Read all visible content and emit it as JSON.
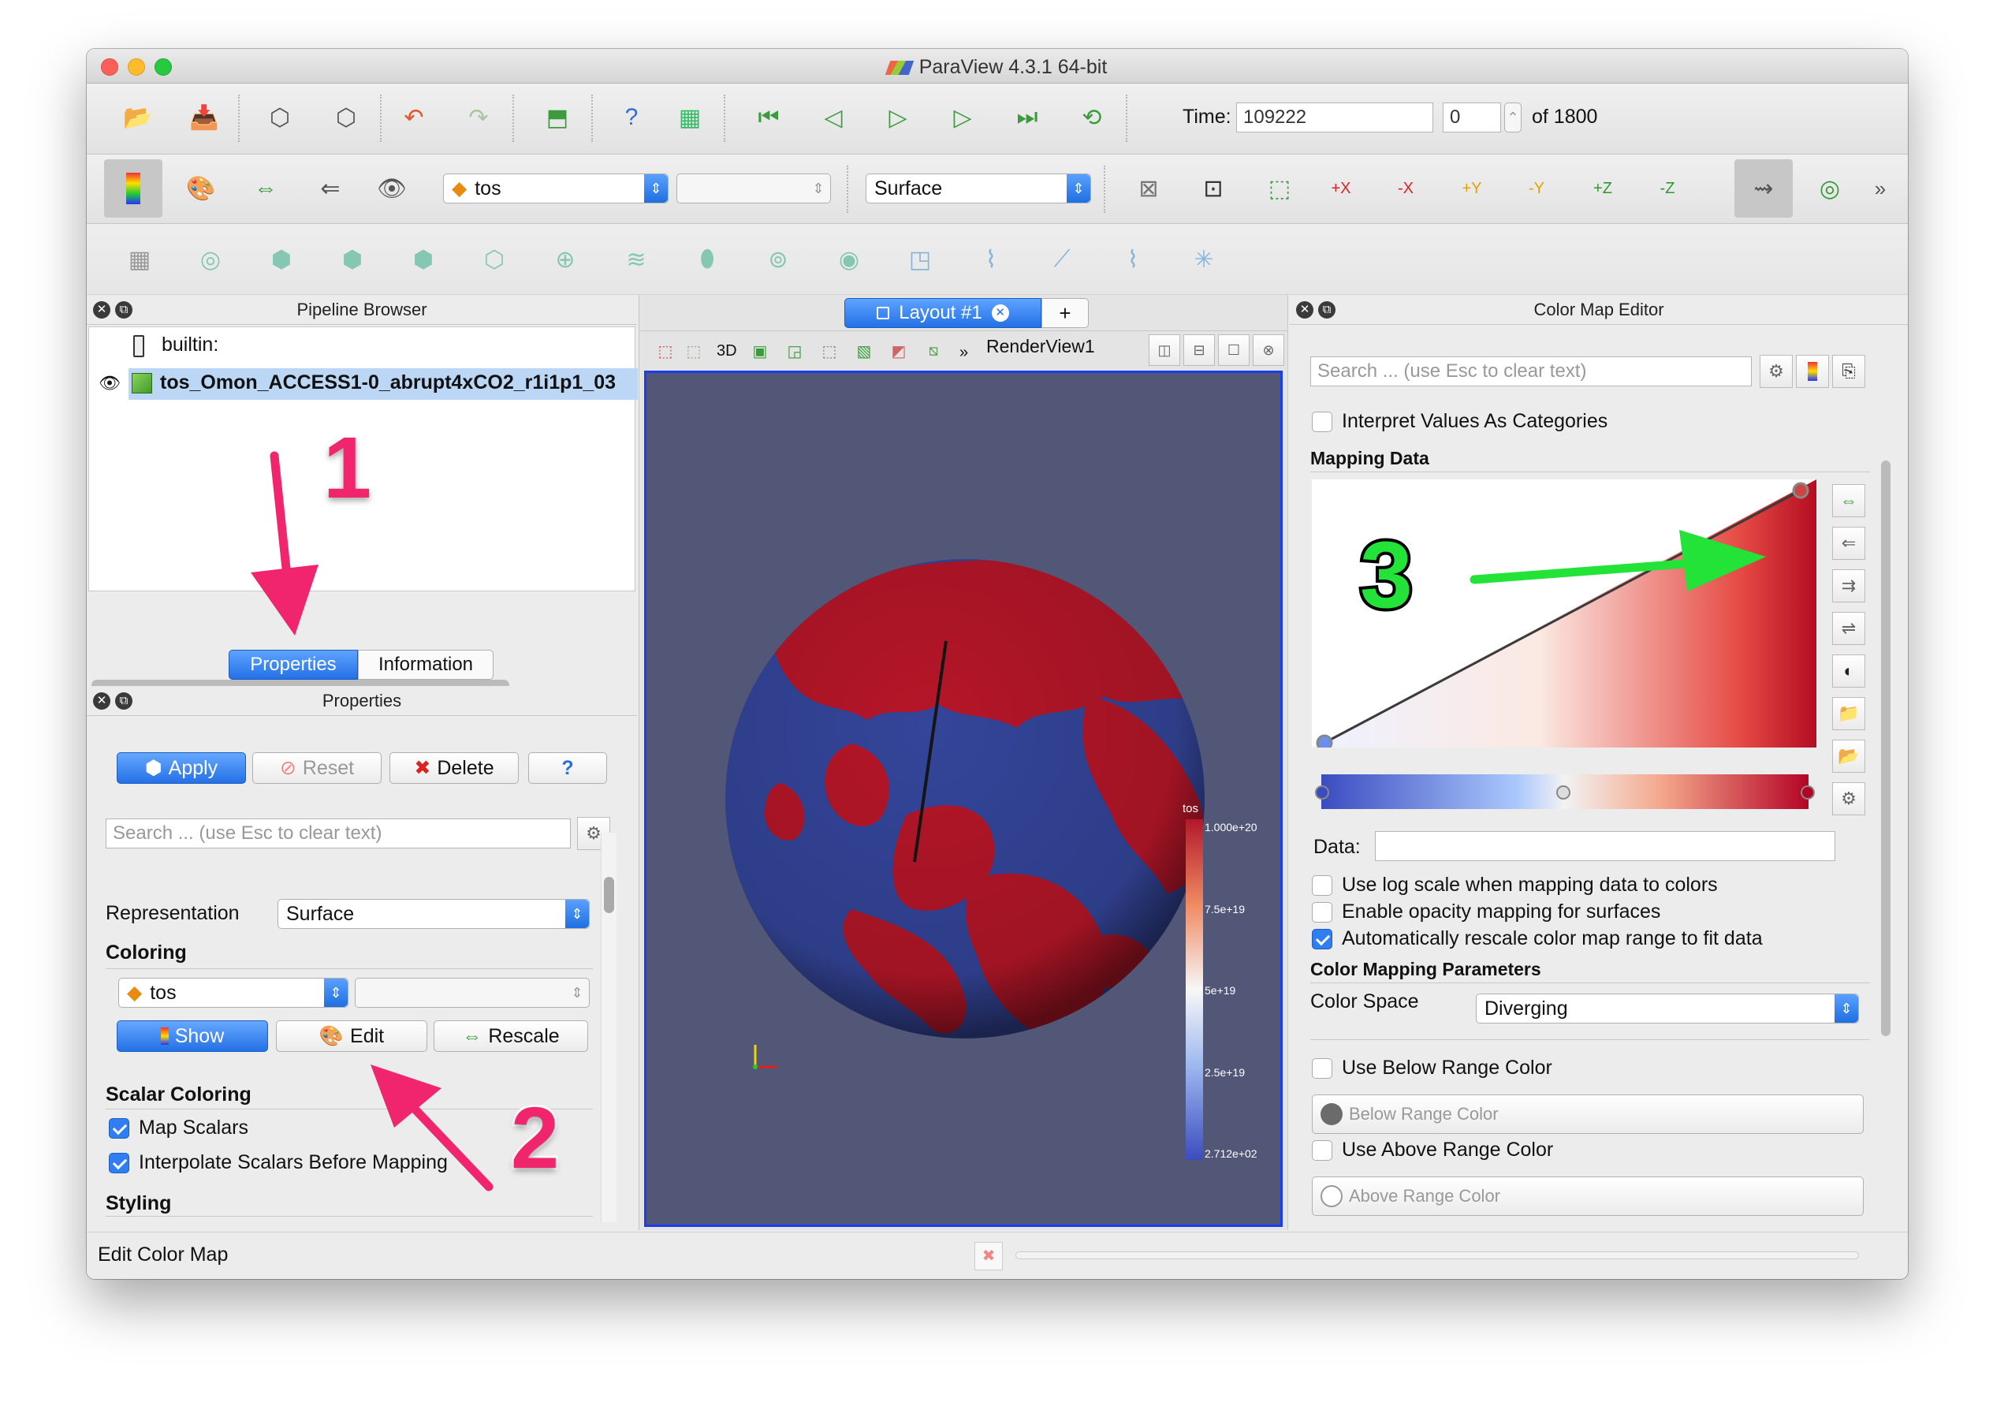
{
  "window": {
    "title": "ParaView 4.3.1 64-bit"
  },
  "toolbar1": {
    "time_label": "Time:",
    "time_value": "109222",
    "timestep_value": "0",
    "of_label": "of 1800"
  },
  "toolbar2": {
    "array_combo": "tos",
    "component_combo": "",
    "representation_combo": "Surface",
    "axis_labels": [
      "+X",
      "-X",
      "+Y",
      "-Y",
      "+Z",
      "-Z"
    ],
    "more": "»"
  },
  "pipeline": {
    "title": "Pipeline Browser",
    "root": "builtin:",
    "source": "tos_Omon_ACCESS1-0_abrupt4xCO2_r1i1p1_03"
  },
  "tabs": {
    "properties": "Properties",
    "information": "Information"
  },
  "properties": {
    "title": "Properties",
    "apply": "Apply",
    "reset": "Reset",
    "delete": "Delete",
    "help": "?",
    "search_placeholder": "Search ... (use Esc to clear text)",
    "representation_label": "Representation",
    "representation_value": "Surface",
    "coloring_label": "Coloring",
    "coloring_array": "tos",
    "coloring_component": "",
    "show": "Show",
    "edit": "Edit",
    "rescale": "Rescale",
    "scalar_coloring": "Scalar Coloring",
    "map_scalars": "Map Scalars",
    "interpolate": "Interpolate Scalars Before Mapping",
    "styling": "Styling"
  },
  "view": {
    "layout_tab": "Layout #1",
    "add_tab": "+",
    "render_view": "RenderView1",
    "three_d": "3D",
    "colorbar_title": "tos",
    "colorbar_ticks": [
      "1.000e+20",
      "7.5e+19",
      "5e+19",
      "2.5e+19",
      "2.712e+02"
    ]
  },
  "colormap": {
    "title": "Color Map Editor",
    "search_placeholder": "Search ... (use Esc to clear text)",
    "interpret": "Interpret Values As Categories",
    "mapping_data": "Mapping Data",
    "data_label": "Data:",
    "log_scale": "Use log scale when mapping data to colors",
    "opacity": "Enable opacity mapping for surfaces",
    "auto_rescale": "Automatically rescale color map range to fit data",
    "params": "Color Mapping Parameters",
    "color_space_label": "Color Space",
    "color_space_value": "Diverging",
    "below": "Use Below Range Color",
    "below_btn": "Below Range Color",
    "above": "Use Above Range Color",
    "above_btn": "Above Range Color"
  },
  "status": {
    "text": "Edit Color Map"
  },
  "annotations": [
    "1",
    "2",
    "3"
  ],
  "colors": {
    "annotation_pink": "#f0256e",
    "annotation_green": "#23e339",
    "selection_blue": "#2f7ef2",
    "globe_red": "#b51628",
    "globe_blue": "#34459a",
    "view_bg": "#525777"
  }
}
